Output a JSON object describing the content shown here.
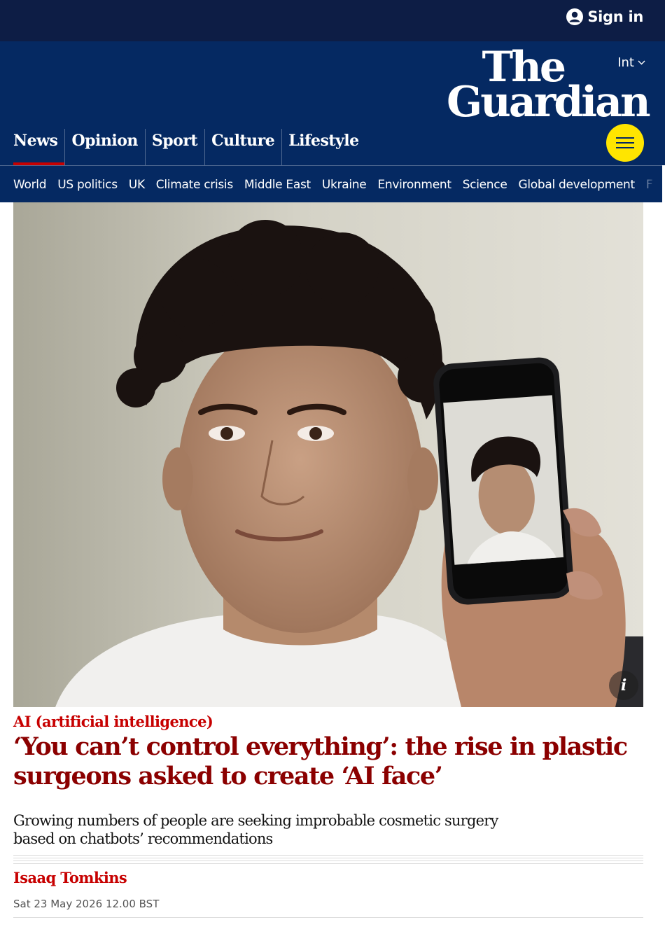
{
  "header": {
    "sign_in_label": "Sign in",
    "edition_label": "Int",
    "logo_line1": "The",
    "logo_line2": "Guardian",
    "menu_icon": "hamburger-icon"
  },
  "pillars": [
    {
      "label": "News",
      "active": true
    },
    {
      "label": "Opinion",
      "active": false
    },
    {
      "label": "Sport",
      "active": false
    },
    {
      "label": "Culture",
      "active": false
    },
    {
      "label": "Lifestyle",
      "active": false
    }
  ],
  "subnav": [
    "World",
    "US politics",
    "UK",
    "Climate crisis",
    "Middle East",
    "Ukraine",
    "Environment",
    "Science",
    "Global development",
    "F"
  ],
  "article": {
    "kicker": "AI (artificial intelligence)",
    "headline": "‘You can’t control everything’: the rise in plastic surgeons asked to create ‘AI face’",
    "standfirst": "Growing numbers of people are seeking improbable cosmetic surgery based on chatbots’ recommendations",
    "byline": "Isaaq Tomkins",
    "date": "Sat 23 May 2026 12.00 BST",
    "image_info_icon": "info-icon"
  },
  "colors": {
    "top_bar": "#0d1d45",
    "brand_blue": "#052962",
    "news_red": "#c70000",
    "headline_red": "#8b0000",
    "menu_yellow": "#ffe500"
  }
}
